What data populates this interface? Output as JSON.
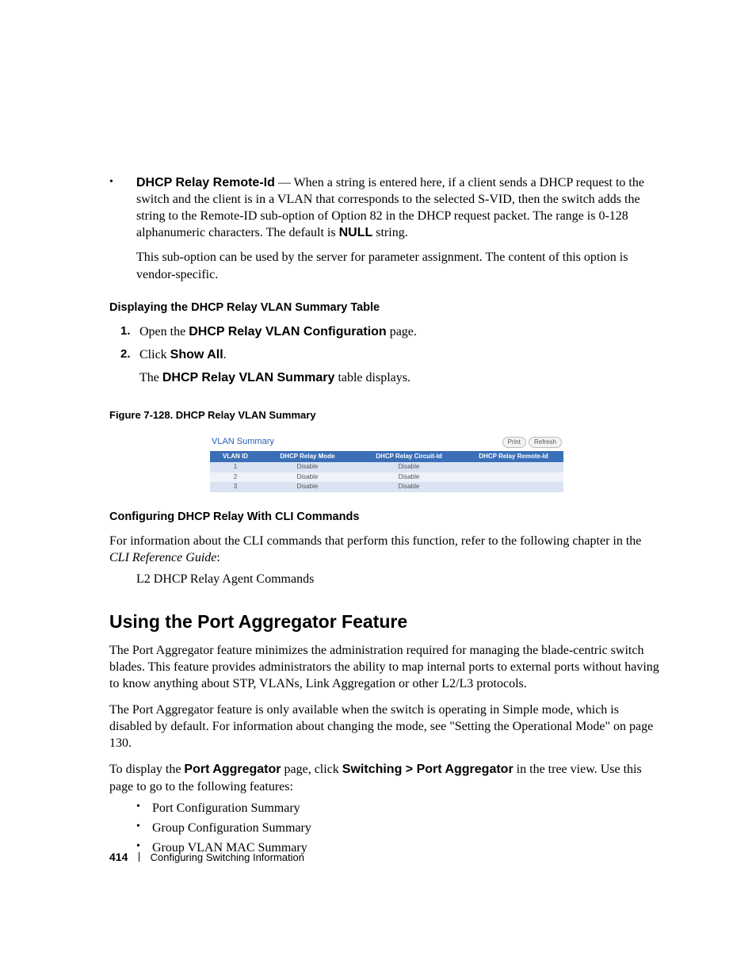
{
  "dhcp_bullet": {
    "label": "DHCP Relay Remote-Id",
    "dash": " — ",
    "text_after": "When a string is entered here, if a client sends a DHCP request to the switch and the client is in a VLAN that corresponds to the selected S-VID, then the switch adds the string to the Remote-ID sub-option of Option 82 in the DHCP request packet. The range is 0-128 alphanumeric characters. The default is ",
    "bold_tail": "NULL",
    "text_tail": " string.",
    "sub_para": "This sub-option can be used by the server for parameter assignment. The content of this option is vendor-specific."
  },
  "heading_display": "Displaying the DHCP Relay VLAN Summary Table",
  "steps": {
    "s1_num": "1.",
    "s1_pre": "Open the ",
    "s1_bold": "DHCP Relay VLAN Configuration",
    "s1_post": " page.",
    "s2_num": "2.",
    "s2_pre": "Click ",
    "s2_bold": "Show All",
    "s2_post": ".",
    "s2_after_pre": "The ",
    "s2_after_bold": "DHCP Relay VLAN Summary",
    "s2_after_post": " table displays."
  },
  "fig_caption": "Figure 7-128.    DHCP Relay VLAN Summary",
  "figure": {
    "title": "VLAN Summary",
    "btn_print": "Print",
    "btn_refresh": "Refresh",
    "headers": {
      "h1": "VLAN ID",
      "h2": "DHCP Relay Mode",
      "h3": "DHCP Relay Circuit-Id",
      "h4": "DHCP Relay Remote-Id"
    },
    "rows": {
      "r1c1": "1",
      "r1c2": "Disable",
      "r1c3": "Disable",
      "r1c4": "",
      "r2c1": "2",
      "r2c2": "Disable",
      "r2c3": "Disable",
      "r2c4": "",
      "r3c1": "3",
      "r3c2": "Disable",
      "r3c3": "Disable",
      "r3c4": ""
    }
  },
  "heading_cli": "Configuring DHCP Relay With CLI Commands",
  "cli_para_pre": "For information about the CLI commands that perform this function, refer to the following chapter in the ",
  "cli_para_italic": "CLI Reference Guide",
  "cli_para_post": ":",
  "cli_ref": "L2 DHCP Relay Agent Commands",
  "h2": "Using the Port Aggregator Feature",
  "pa_para1": "The Port Aggregator feature minimizes the administration required for managing the blade-centric switch blades. This feature provides administrators the ability to map internal ports to external ports without having to know anything about STP, VLANs, Link Aggregation or other L2/L3 protocols.",
  "pa_para2": "The Port Aggregator feature is only available when the switch is operating in Simple mode, which is disabled by default. For information about changing the mode, see \"Setting the Operational Mode\" on page 130.",
  "pa_para3_pre": "To display the ",
  "pa_para3_b1": "Port Aggregator",
  "pa_para3_mid": " page, click ",
  "pa_para3_b2": "Switching > Port Aggregator",
  "pa_para3_post": " in the tree view. Use this page to go to the following features:",
  "pa_list": {
    "i1": "Port Configuration Summary",
    "i2": "Group Configuration Summary",
    "i3": "Group VLAN MAC Summary"
  },
  "footer": {
    "page": "414",
    "chapter": "Configuring Switching Information"
  }
}
